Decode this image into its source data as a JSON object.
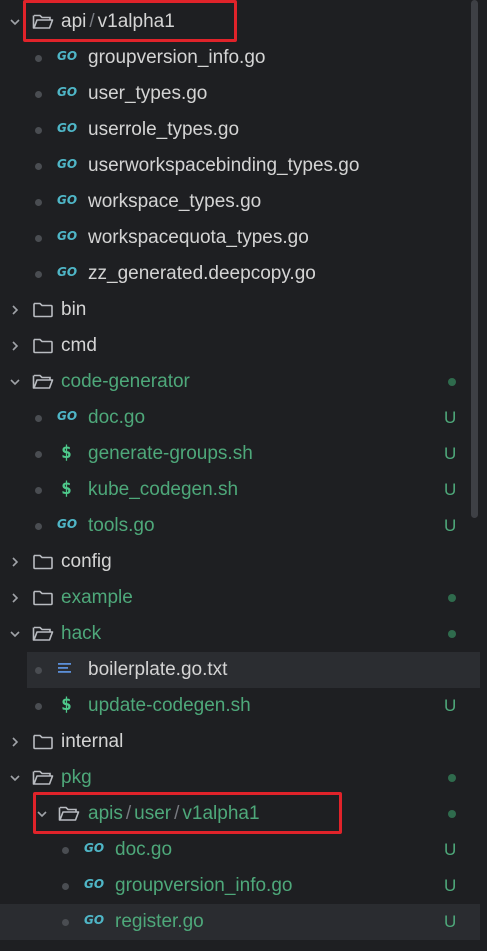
{
  "rows": [
    {
      "label_parts": [
        "api",
        "v1alpha1"
      ],
      "kind": "folder-open",
      "depth": 0,
      "expanded": true,
      "color": "normal",
      "status": ""
    },
    {
      "label": "groupversion_info.go",
      "kind": "go",
      "depth": 1,
      "color": "normal",
      "status": ""
    },
    {
      "label": "user_types.go",
      "kind": "go",
      "depth": 1,
      "color": "normal",
      "status": ""
    },
    {
      "label": "userrole_types.go",
      "kind": "go",
      "depth": 1,
      "color": "normal",
      "status": ""
    },
    {
      "label": "userworkspacebinding_types.go",
      "kind": "go",
      "depth": 1,
      "color": "normal",
      "status": ""
    },
    {
      "label": "workspace_types.go",
      "kind": "go",
      "depth": 1,
      "color": "normal",
      "status": ""
    },
    {
      "label": "workspacequota_types.go",
      "kind": "go",
      "depth": 1,
      "color": "normal",
      "status": ""
    },
    {
      "label": "zz_generated.deepcopy.go",
      "kind": "go",
      "depth": 1,
      "color": "normal",
      "status": ""
    },
    {
      "label": "bin",
      "kind": "folder",
      "depth": 0,
      "expanded": false,
      "color": "normal",
      "status": ""
    },
    {
      "label": "cmd",
      "kind": "folder",
      "depth": 0,
      "expanded": false,
      "color": "normal",
      "status": ""
    },
    {
      "label": "code-generator",
      "kind": "folder-open",
      "depth": 0,
      "expanded": true,
      "color": "green",
      "status": "dot"
    },
    {
      "label": "doc.go",
      "kind": "go",
      "depth": 1,
      "color": "green",
      "status": "U"
    },
    {
      "label": "generate-groups.sh",
      "kind": "sh",
      "depth": 1,
      "color": "green",
      "status": "U"
    },
    {
      "label": "kube_codegen.sh",
      "kind": "sh",
      "depth": 1,
      "color": "green",
      "status": "U"
    },
    {
      "label": "tools.go",
      "kind": "go",
      "depth": 1,
      "color": "green",
      "status": "U"
    },
    {
      "label": "config",
      "kind": "folder",
      "depth": 0,
      "expanded": false,
      "color": "normal",
      "status": ""
    },
    {
      "label": "example",
      "kind": "folder",
      "depth": 0,
      "expanded": false,
      "color": "green",
      "status": "dot"
    },
    {
      "label": "hack",
      "kind": "folder-open",
      "depth": 0,
      "expanded": true,
      "color": "green",
      "status": "dot"
    },
    {
      "label": "boilerplate.go.txt",
      "kind": "txt",
      "depth": 1,
      "color": "normal",
      "status": "",
      "selected": true
    },
    {
      "label": "update-codegen.sh",
      "kind": "sh",
      "depth": 1,
      "color": "green",
      "status": "U"
    },
    {
      "label": "internal",
      "kind": "folder",
      "depth": 0,
      "expanded": false,
      "color": "normal",
      "status": ""
    },
    {
      "label": "pkg",
      "kind": "folder-open",
      "depth": 0,
      "expanded": true,
      "color": "green",
      "status": "dot"
    },
    {
      "label_parts": [
        "apis",
        "user",
        "v1alpha1"
      ],
      "kind": "folder-open",
      "depth": 1,
      "expanded": true,
      "color": "green",
      "status": "dot"
    },
    {
      "label": "doc.go",
      "kind": "go",
      "depth": 2,
      "color": "green",
      "status": "U"
    },
    {
      "label": "groupversion_info.go",
      "kind": "go",
      "depth": 2,
      "color": "green",
      "status": "U"
    },
    {
      "label": "register.go",
      "kind": "go",
      "depth": 2,
      "color": "green",
      "status": "U",
      "hover": true
    }
  ],
  "icons": {
    "go": "go-file-icon",
    "sh": "shell-script-icon",
    "txt": "text-file-icon",
    "folder": "folder-icon",
    "folder-open": "folder-open-icon"
  },
  "colors": {
    "green": "#4ea87a",
    "normal": "#d4d4d4",
    "highlight": "#e0232a",
    "background": "#1e1f22"
  }
}
